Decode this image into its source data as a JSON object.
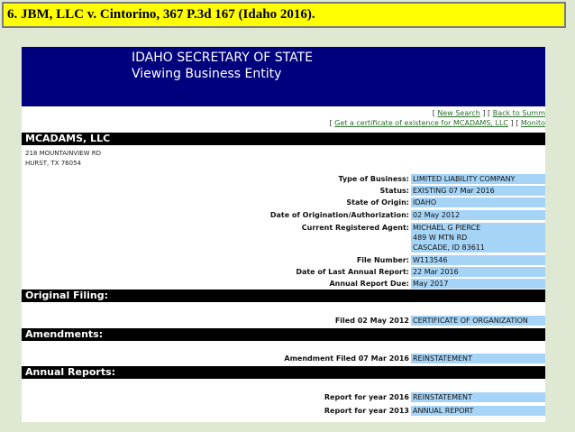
{
  "slide": {
    "title": "6. JBM, LLC v. Cintorino, 367 P.3d 167 (Idaho 2016)."
  },
  "header": {
    "line1": "IDAHO SECRETARY OF STATE",
    "line2": "Viewing Business Entity"
  },
  "links": {
    "row1_open": "[ ",
    "new_search": "New Search",
    "row1_mid": " ] [ ",
    "back_to_summary": "Back to Summ",
    "row2_open": "[ ",
    "get_certificate": "Get a certificate of existence for MCADAMS, LLC",
    "row2_mid": " ] [ ",
    "monitor": "Monito"
  },
  "entity": {
    "name": "MCADAMS, LLC",
    "address_line1": "218 MOUNTAINVIEW RD",
    "address_line2": "HURST, TX 76054"
  },
  "details": [
    {
      "label": "Type of Business:",
      "value": "LIMITED LIABILITY COMPANY"
    },
    {
      "label": "Status:",
      "value": "EXISTING 07 Mar 2016"
    },
    {
      "label": "State of Origin:",
      "value": "IDAHO"
    },
    {
      "label": "Date of Origination/Authorization:",
      "value": "02 May 2012"
    },
    {
      "label": "Current Registered Agent:",
      "value": "MICHAEL G PIERCE",
      "value2": "489 W MTN RD",
      "value3": "CASCADE, ID 83611"
    },
    {
      "label": "File Number:",
      "value": "W113546"
    },
    {
      "label": "Date of Last Annual Report:",
      "value": "22 Mar 2016"
    },
    {
      "label": "Annual Report Due:",
      "value": "May 2017"
    }
  ],
  "sections": {
    "original_filing": "Original Filing:",
    "amendments": "Amendments:",
    "annual_reports": "Annual Reports:"
  },
  "original_filing": {
    "label": "Filed 02 May 2012",
    "value": "CERTIFICATE OF ORGANIZATION"
  },
  "amendment": {
    "label": "Amendment Filed 07 Mar 2016",
    "value": "REINSTATEMENT"
  },
  "annual_reports": [
    {
      "label": "Report for year 2016",
      "value": "REINSTATEMENT"
    },
    {
      "label": "Report for year 2013",
      "value": "ANNUAL REPORT"
    }
  ]
}
